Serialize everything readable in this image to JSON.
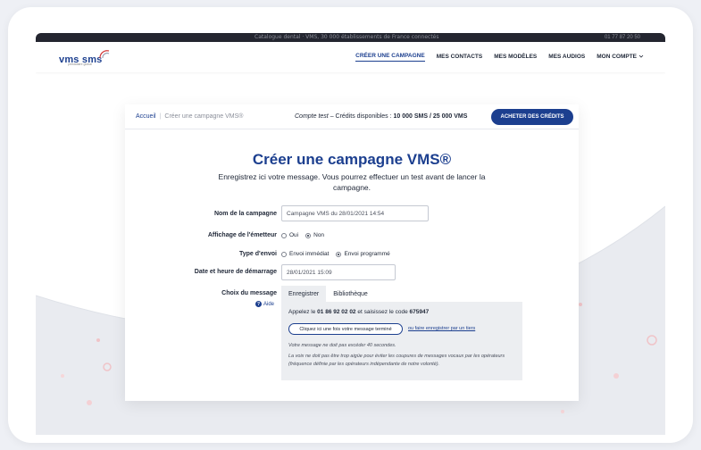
{
  "topbar": {
    "text": "Catalogue dental · VMS, 30 000 établissements de France connectés",
    "phone": "01 77 87 20 50"
  },
  "brand": {
    "logo": "vms sms",
    "tagline": "prestataire global"
  },
  "nav": {
    "items": [
      {
        "label": "CRÉER UNE CAMPAGNE",
        "active": true
      },
      {
        "label": "MES CONTACTS"
      },
      {
        "label": "MES MODÈLES"
      },
      {
        "label": "MES AUDIOS"
      },
      {
        "label": "MON COMPTE"
      }
    ],
    "dropdown_icon": "chevron-down-icon"
  },
  "breadcrumb": {
    "home": "Accueil",
    "separator": "|",
    "current": "Créer une campagne VMS®"
  },
  "credits": {
    "account": "Compte test",
    "text": " – Crédits disponibles : ",
    "amounts": "10 000 SMS / 25 000 VMS"
  },
  "buy_button": "ACHETER DES CRÉDITS",
  "page": {
    "title": "Créer une campagne VMS®",
    "subtitle": "Enregistrez ici votre message. Vous pourrez effectuer un test avant de lancer la campagne."
  },
  "form": {
    "campaign_name": {
      "label": "Nom de la campagne",
      "value": "Campagne VMS du 28/01/2021 14:54"
    },
    "sender_display": {
      "label": "Affichage de l'émetteur",
      "options": [
        "Oui",
        "Non"
      ],
      "selected": "Non"
    },
    "send_type": {
      "label": "Type d'envoi",
      "options": [
        "Envoi immédiat",
        "Envoi programmé"
      ],
      "selected": "Envoi programmé"
    },
    "start_datetime": {
      "label": "Date et heure de démarrage",
      "value": "28/01/2021 15:09"
    },
    "message_choice": {
      "label": "Choix du message",
      "help": "Aide",
      "tabs": [
        "Enregistrer",
        "Bibliothèque"
      ],
      "active_tab": "Enregistrer",
      "call_text": "Appelez le ",
      "phone": "01 86 92 02 02",
      "code_text": " et saisissez le code ",
      "code": "675947",
      "done_button": "Cliquez ici une fois votre message terminé",
      "record_link": "ou faire enregistrer par un tiers",
      "note1": "Votre message ne doit pas excéder 40 secondes.",
      "note2": "La voix ne doit pas être trop aigüe pour éviter les coupures de messages vocaux par les opérateurs (fréquence définie par les opérateurs indépendante de notre volonté)."
    }
  },
  "colors": {
    "brand": "#1c3f8f",
    "panel": "#eceef1",
    "topbar": "#242630"
  }
}
